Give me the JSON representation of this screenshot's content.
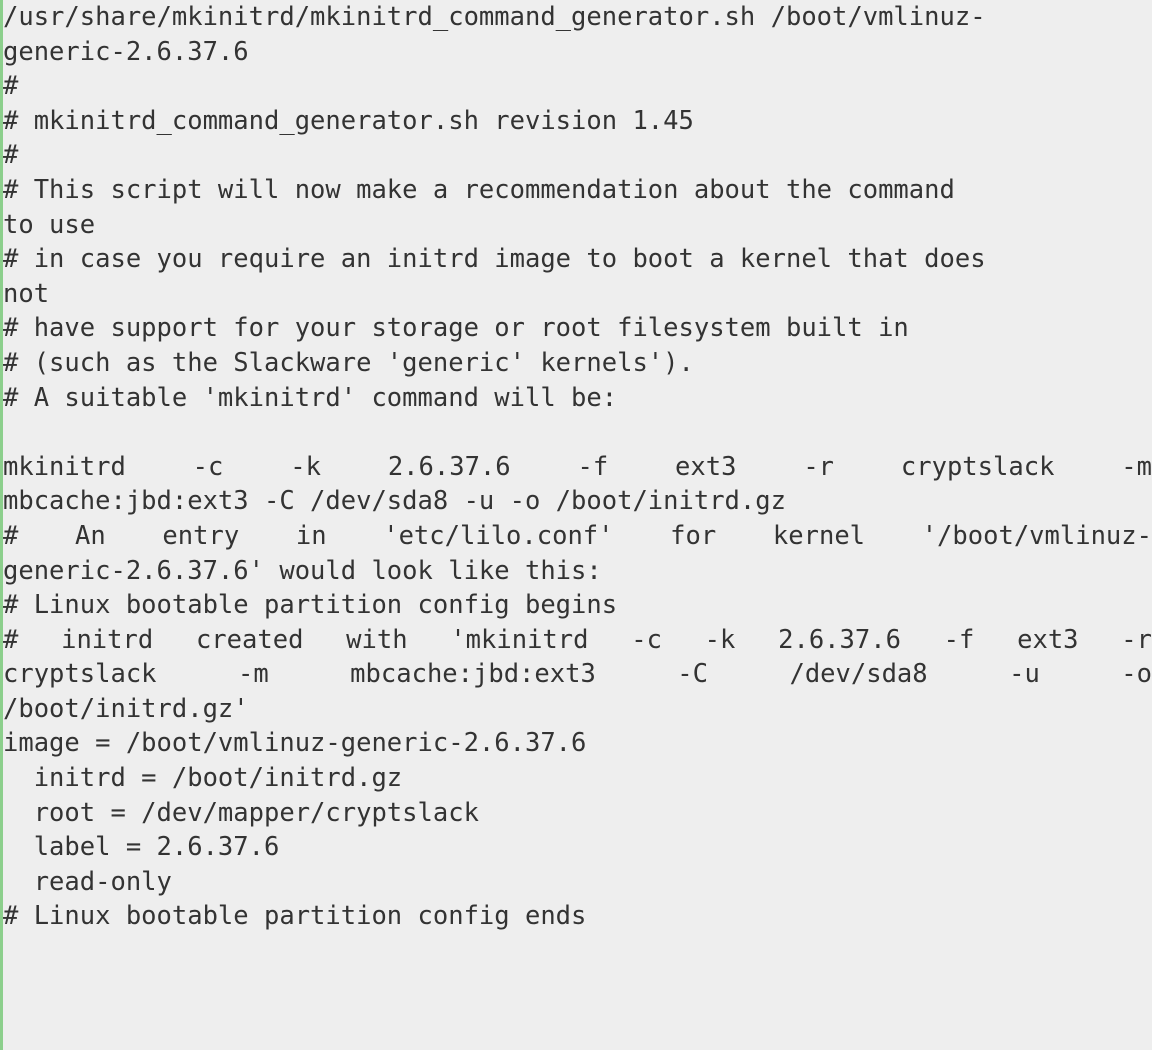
{
  "code_block": {
    "lines": [
      "/usr/share/mkinitrd/mkinitrd_command_generator.sh /boot/vmlinuz-",
      "generic-2.6.37.6",
      "#",
      "# mkinitrd_command_generator.sh revision 1.45",
      "#",
      "# This script will now make a recommendation about the command",
      "to use",
      "# in case you require an initrd image to boot a kernel that does",
      "not",
      "# have support for your storage or root filesystem built in",
      "# (such as the Slackware 'generic' kernels').",
      "# A suitable 'mkinitrd' command will be:",
      "",
      "mkinitrd -c -k 2.6.37.6 -f ext3 -r cryptslack -m",
      "mbcache:jbd:ext3 -C /dev/sda8 -u -o /boot/initrd.gz",
      "# An entry in 'etc/lilo.conf' for kernel '/boot/vmlinuz-",
      "generic-2.6.37.6' would look like this:",
      "# Linux bootable partition config begins",
      "# initrd created with 'mkinitrd -c -k 2.6.37.6 -f ext3 -r",
      "cryptslack -m mbcache:jbd:ext3 -C /dev/sda8 -u -o",
      "/boot/initrd.gz'",
      "image = /boot/vmlinuz-generic-2.6.37.6",
      "  initrd = /boot/initrd.gz",
      "  root = /dev/mapper/cryptslack",
      "  label = 2.6.37.6",
      "  read-only",
      "# Linux bootable partition config ends"
    ]
  }
}
